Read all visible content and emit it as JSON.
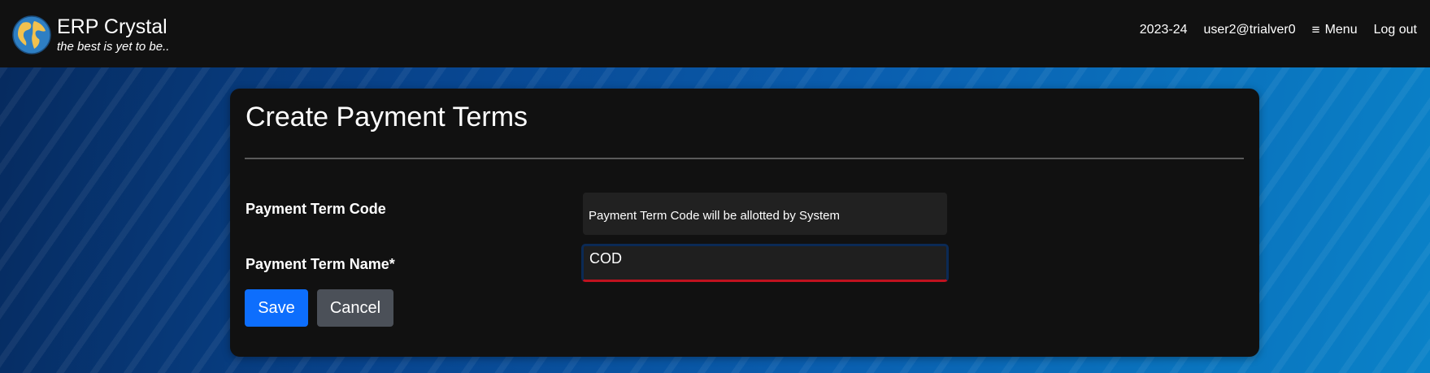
{
  "header": {
    "brand_title": "ERP Crystal",
    "brand_tagline": "the best is yet to be..",
    "fiscal_year": "2023-24",
    "user": "user2@trialver0",
    "menu_label": "Menu",
    "logout_label": "Log out",
    "logo_icon": "globe-icon",
    "menu_icon": "hamburger-icon"
  },
  "form": {
    "title": "Create Payment Terms",
    "code_label": "Payment Term Code",
    "code_value": "Payment Term Code will be allotted by System",
    "name_label": "Payment Term Name*",
    "name_value": "COD",
    "save_label": "Save",
    "cancel_label": "Cancel"
  },
  "colors": {
    "topbar": "#111111",
    "card": "#111111",
    "save_button": "#0d6efd",
    "cancel_button": "#4b5058",
    "input_invalid_border": "#c1121f"
  }
}
